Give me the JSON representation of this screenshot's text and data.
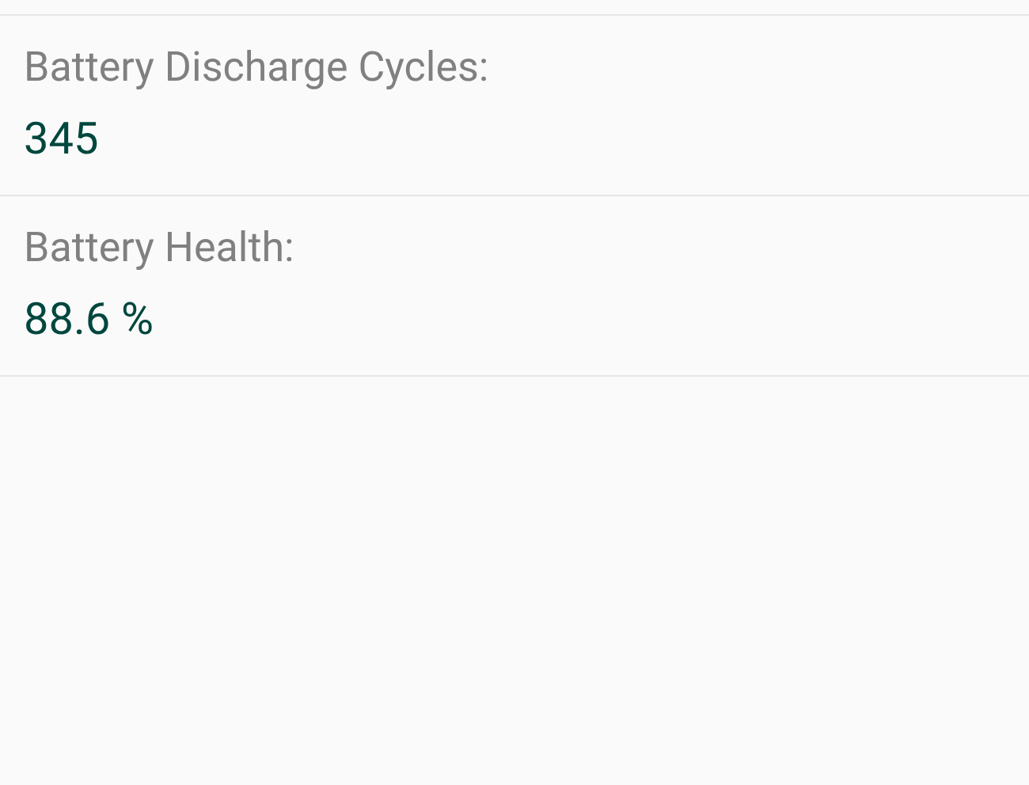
{
  "items": [
    {
      "label": "Battery Discharge Cycles:",
      "value": "345"
    },
    {
      "label": "Battery Health:",
      "value": "88.6 %"
    }
  ]
}
